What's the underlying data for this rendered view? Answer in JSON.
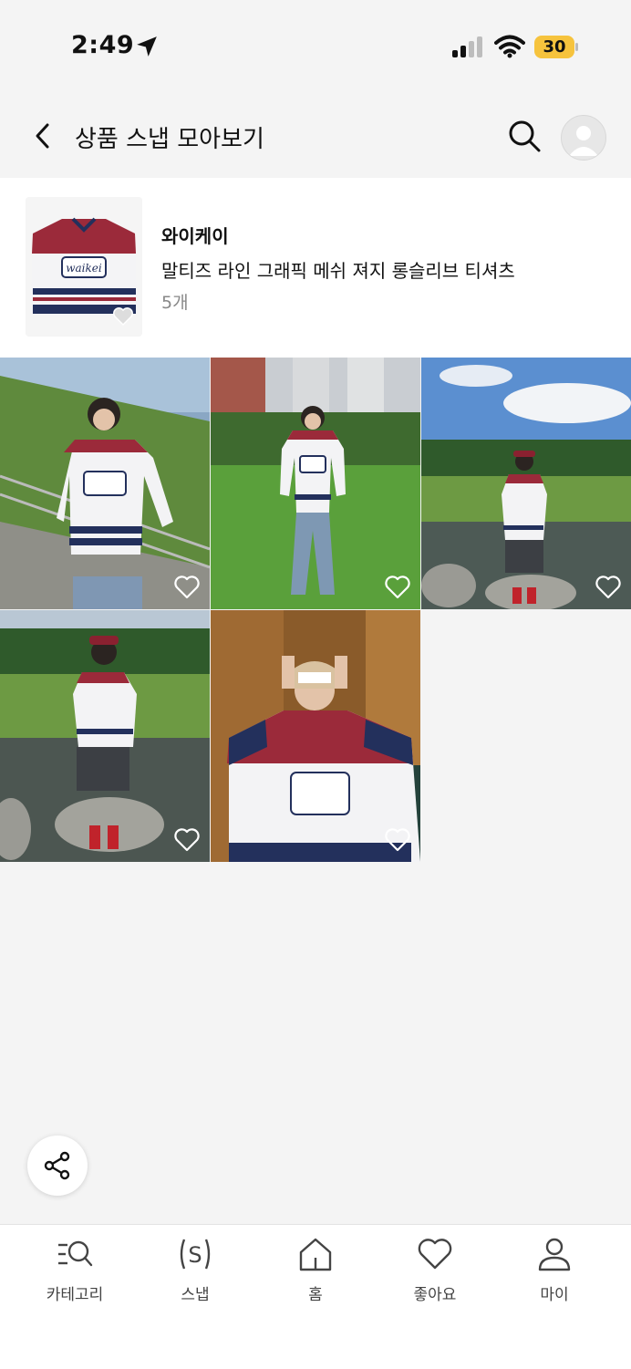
{
  "status_bar": {
    "time": "2:49",
    "battery": "30"
  },
  "header": {
    "title": "상품 스냅 모아보기"
  },
  "product": {
    "brand": "와이케이",
    "name": "말티즈 라인 그래픽 메쉬 져지 롱슬리브 티셔츠",
    "count": "5개"
  },
  "tabs": [
    {
      "label": "카테고리",
      "icon": "category-search-icon"
    },
    {
      "label": "스냅",
      "icon": "snap-icon"
    },
    {
      "label": "홈",
      "icon": "home-icon"
    },
    {
      "label": "좋아요",
      "icon": "heart-icon"
    },
    {
      "label": "마이",
      "icon": "person-icon"
    }
  ],
  "colors": {
    "background": "#f4f4f4",
    "battery": "#f6c33d",
    "jersey_red": "#9b2a3a",
    "jersey_navy": "#23305c"
  }
}
